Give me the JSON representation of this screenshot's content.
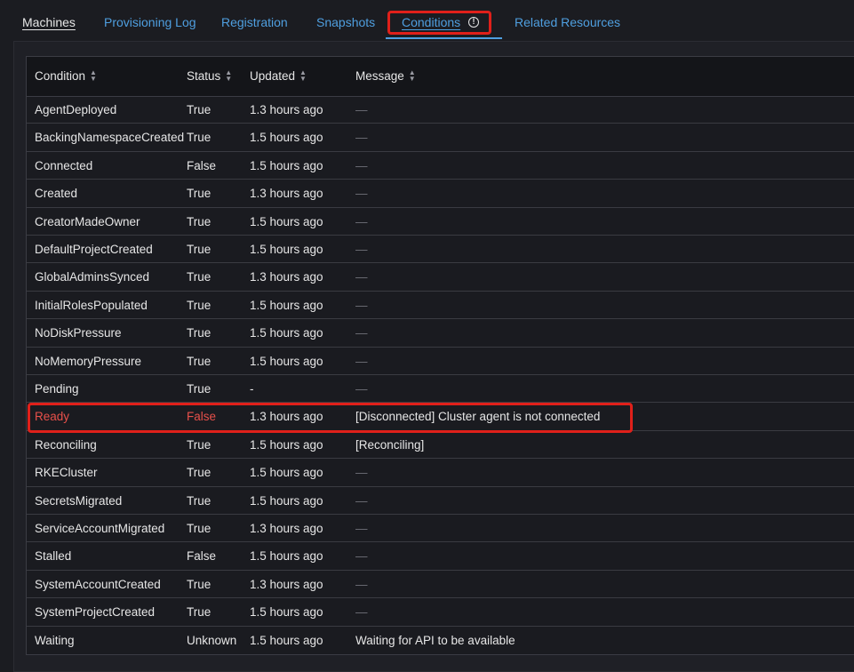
{
  "tabs": [
    {
      "label": "Machines"
    },
    {
      "label": "Provisioning Log"
    },
    {
      "label": "Registration"
    },
    {
      "label": "Snapshots"
    },
    {
      "label": "Conditions"
    },
    {
      "label": "Related Resources"
    }
  ],
  "table": {
    "columns": [
      "Condition",
      "Status",
      "Updated",
      "Message"
    ],
    "rows": [
      {
        "condition": "AgentDeployed",
        "status": "True",
        "updated": "1.3 hours ago",
        "message": "—"
      },
      {
        "condition": "BackingNamespaceCreated",
        "status": "True",
        "updated": "1.5 hours ago",
        "message": "—"
      },
      {
        "condition": "Connected",
        "status": "False",
        "updated": "1.5 hours ago",
        "message": "—"
      },
      {
        "condition": "Created",
        "status": "True",
        "updated": "1.3 hours ago",
        "message": "—"
      },
      {
        "condition": "CreatorMadeOwner",
        "status": "True",
        "updated": "1.5 hours ago",
        "message": "—"
      },
      {
        "condition": "DefaultProjectCreated",
        "status": "True",
        "updated": "1.5 hours ago",
        "message": "—"
      },
      {
        "condition": "GlobalAdminsSynced",
        "status": "True",
        "updated": "1.3 hours ago",
        "message": "—"
      },
      {
        "condition": "InitialRolesPopulated",
        "status": "True",
        "updated": "1.5 hours ago",
        "message": "—"
      },
      {
        "condition": "NoDiskPressure",
        "status": "True",
        "updated": "1.5 hours ago",
        "message": "—"
      },
      {
        "condition": "NoMemoryPressure",
        "status": "True",
        "updated": "1.5 hours ago",
        "message": "—"
      },
      {
        "condition": "Pending",
        "status": "True",
        "updated": "-",
        "message": "—"
      },
      {
        "condition": "Ready",
        "status": "False",
        "updated": "1.3 hours ago",
        "message": "[Disconnected] Cluster agent is not connected"
      },
      {
        "condition": "Reconciling",
        "status": "True",
        "updated": "1.5 hours ago",
        "message": "[Reconciling]"
      },
      {
        "condition": "RKECluster",
        "status": "True",
        "updated": "1.5 hours ago",
        "message": "—"
      },
      {
        "condition": "SecretsMigrated",
        "status": "True",
        "updated": "1.5 hours ago",
        "message": "—"
      },
      {
        "condition": "ServiceAccountMigrated",
        "status": "True",
        "updated": "1.3 hours ago",
        "message": "—"
      },
      {
        "condition": "Stalled",
        "status": "False",
        "updated": "1.5 hours ago",
        "message": "—"
      },
      {
        "condition": "SystemAccountCreated",
        "status": "True",
        "updated": "1.3 hours ago",
        "message": "—"
      },
      {
        "condition": "SystemProjectCreated",
        "status": "True",
        "updated": "1.5 hours ago",
        "message": "—"
      },
      {
        "condition": "Waiting",
        "status": "Unknown",
        "updated": "1.5 hours ago",
        "message": "Waiting for API to be available"
      }
    ]
  },
  "colors": {
    "accent": "#4f9fe0",
    "alert": "#e8504a",
    "highlight_box": "#e0201a"
  },
  "icons": {
    "conditions_tab": "warning-circle-icon",
    "column_sort": "sort-icon"
  }
}
